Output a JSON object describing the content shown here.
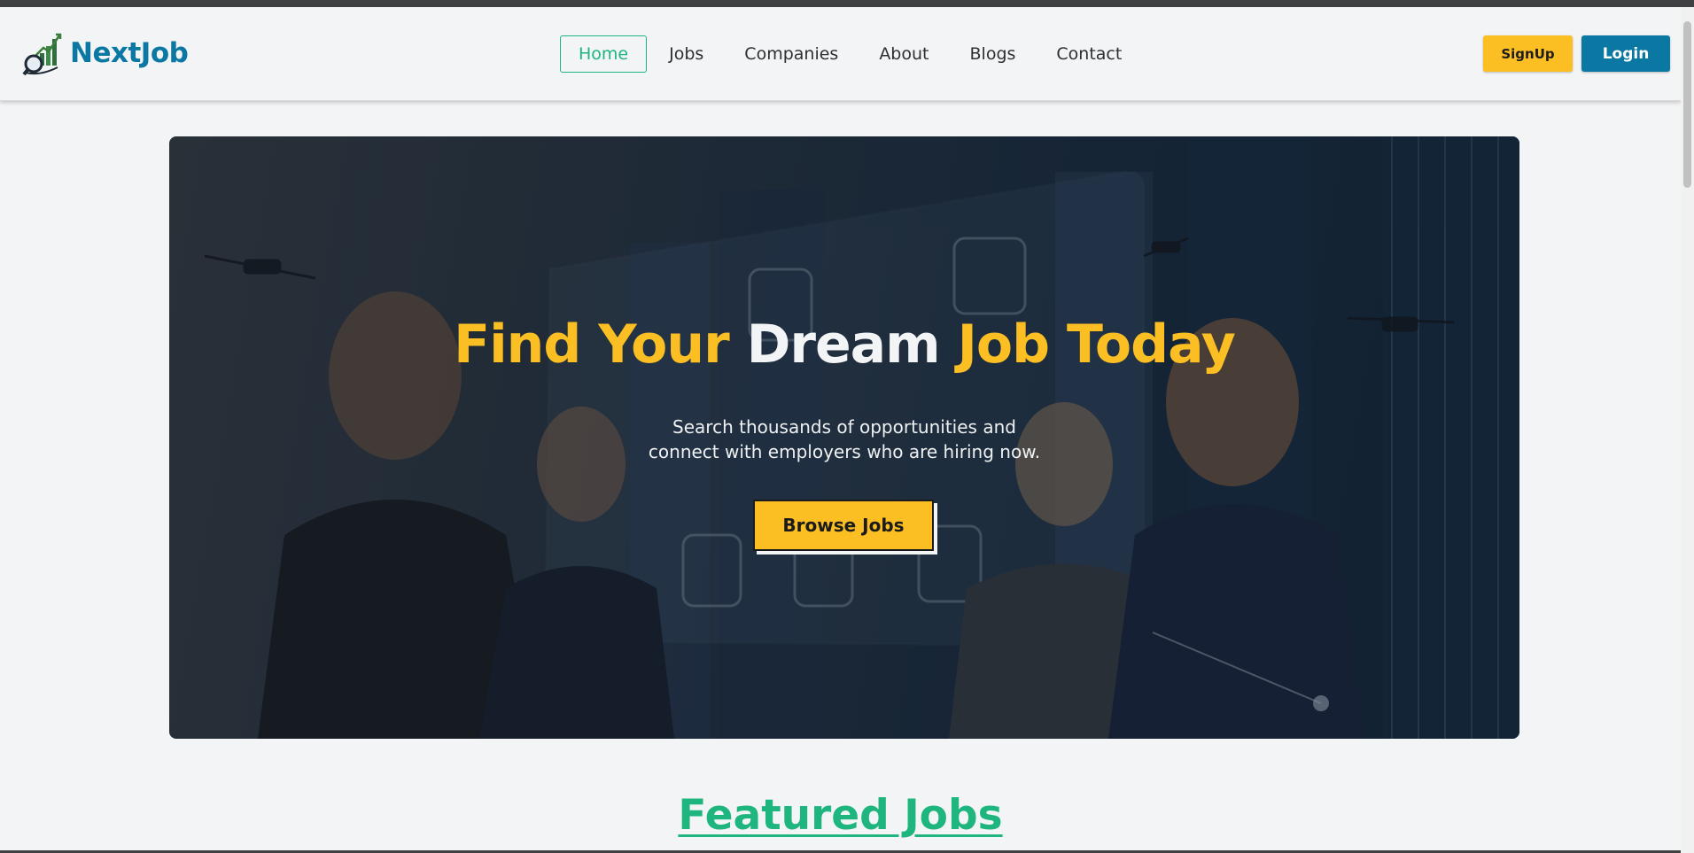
{
  "brand": {
    "name": "NextJob",
    "logo_icon": "growth-chart-magnifier-icon"
  },
  "nav": {
    "items": [
      {
        "label": "Home",
        "active": true
      },
      {
        "label": "Jobs",
        "active": false
      },
      {
        "label": "Companies",
        "active": false
      },
      {
        "label": "About",
        "active": false
      },
      {
        "label": "Blogs",
        "active": false
      },
      {
        "label": "Contact",
        "active": false
      }
    ],
    "signup_label": "SignUp",
    "login_label": "Login"
  },
  "hero": {
    "title_part1": "Find Your",
    "title_part2": "Dream",
    "title_part3": "Job Today",
    "subtitle_line1": "Search thousands of opportunities and",
    "subtitle_line2": "connect with employers who are hiring now.",
    "cta_label": "Browse Jobs"
  },
  "featured": {
    "title": "Featured Jobs"
  },
  "colors": {
    "brand_blue": "#0b78a3",
    "accent_yellow": "#fbbf24",
    "accent_green": "#1fb57f",
    "page_bg": "#f3f4f5"
  }
}
